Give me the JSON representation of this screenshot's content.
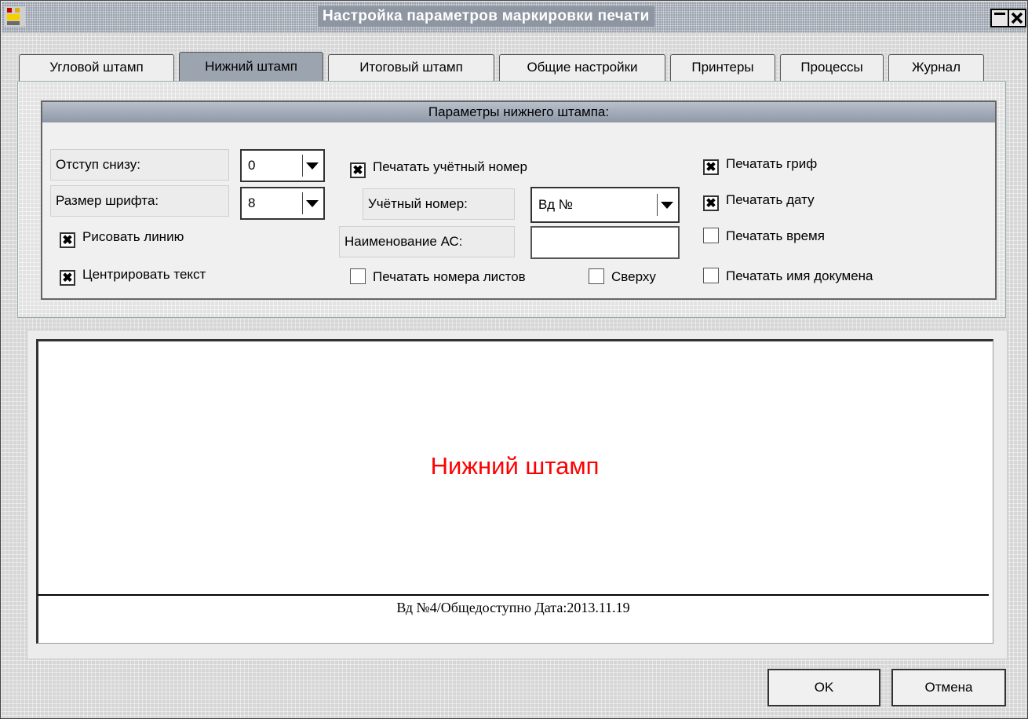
{
  "window": {
    "title": "Настройка параметров маркировки печати"
  },
  "tabs": [
    {
      "label": "Угловой штамп"
    },
    {
      "label": "Нижний штамп"
    },
    {
      "label": "Итоговый штамп"
    },
    {
      "label": "Общие настройки"
    },
    {
      "label": "Принтеры"
    },
    {
      "label": "Процессы"
    },
    {
      "label": "Журнал"
    }
  ],
  "group": {
    "header": "Параметры нижнего штампа:",
    "bottom_offset": {
      "label": "Отступ снизу:",
      "value": "0"
    },
    "font_size": {
      "label": "Размер шрифта:",
      "value": "8"
    },
    "draw_line": {
      "label": "Рисовать линию",
      "checked": true
    },
    "center_text": {
      "label": "Центрировать текст",
      "checked": true
    },
    "print_account_number": {
      "label": "Печатать учётный номер",
      "checked": true
    },
    "account_number": {
      "label": "Учётный номер:",
      "value": "Вд №"
    },
    "as_name": {
      "label": "Наименование АС:",
      "value": ""
    },
    "print_sheet_numbers": {
      "label": "Печатать номера листов",
      "checked": false
    },
    "on_top": {
      "label": "Сверху",
      "checked": false
    },
    "print_classification": {
      "label": "Печатать гриф",
      "checked": true
    },
    "print_date": {
      "label": "Печатать дату",
      "checked": true
    },
    "print_time": {
      "label": "Печатать время",
      "checked": false
    },
    "print_doc_name": {
      "label": "Печатать имя докумена",
      "checked": false
    }
  },
  "preview": {
    "title": "Нижний штамп",
    "stamp_text": "Вд №4/Общедоступно Дата:2013.11.19",
    "title_color": "#ff0000"
  },
  "buttons": {
    "ok": "OK",
    "cancel": "Отмена"
  },
  "icons": {
    "app": "app-icon",
    "minimize": "minimize-icon",
    "close": "close-icon"
  },
  "check_mark": "✖"
}
